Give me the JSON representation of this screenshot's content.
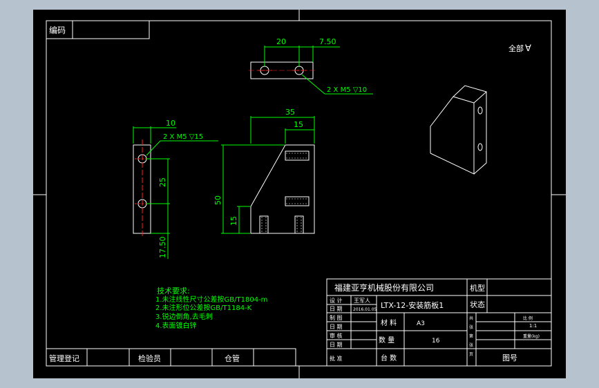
{
  "colors": {
    "background": "#b7c2cf",
    "sheet": "#000000",
    "line": "#ffffff",
    "dimension": "#00ff00",
    "centerline": "#ff2020",
    "text": "#ffffff",
    "notes": "#00ff00"
  },
  "header": {
    "code_label": "编码"
  },
  "corner": {
    "roughness_label": "全部",
    "roughness_symbol": "∀"
  },
  "dimensions": {
    "top_spacing": "20",
    "top_edge": "7.50",
    "top_hole_callout": "2 X M5 ▽10",
    "side_width": "10",
    "side_hole_callout": "2 X M5 ▽15",
    "side_spacing": "25",
    "side_bottom": "17.50",
    "front_width": "35",
    "front_step": "15",
    "front_height": "50",
    "front_low": "15"
  },
  "notes": {
    "title": "技术要求:",
    "items": [
      "1.未注线性尺寸公差按GB/T1804-m",
      "2.未注形位公差按GB/T1184-K",
      "3.锐边倒角,去毛刺",
      "4.表面镀白锌"
    ]
  },
  "title_block": {
    "company": "福建亚亨机械股份有限公司",
    "machine_type_label": "机型",
    "status_label": "状态",
    "part_name": "LTX-12-安装筋板1",
    "design_label": "设 计",
    "designer": "王军人",
    "design_date": "2016.01.05",
    "date_label": "日 期",
    "drafting_label": "制 图",
    "check_label": "审 核",
    "approve_label": "批 准",
    "material_label": "材 料",
    "material_value": "A3",
    "quantity_label": "数 量",
    "quantity_value": "16",
    "machine_count_label": "台 数",
    "ratio_label": "比 例",
    "ratio_value": "1:1",
    "weight_label": "重量(kg)",
    "drawing_no_label": "图号",
    "side_labels": [
      "共",
      "张",
      "第",
      "张",
      "页"
    ]
  },
  "bottom_bar": {
    "register_label": "管理登记",
    "inspector_label": "检验员",
    "storage_label": "仓管"
  }
}
